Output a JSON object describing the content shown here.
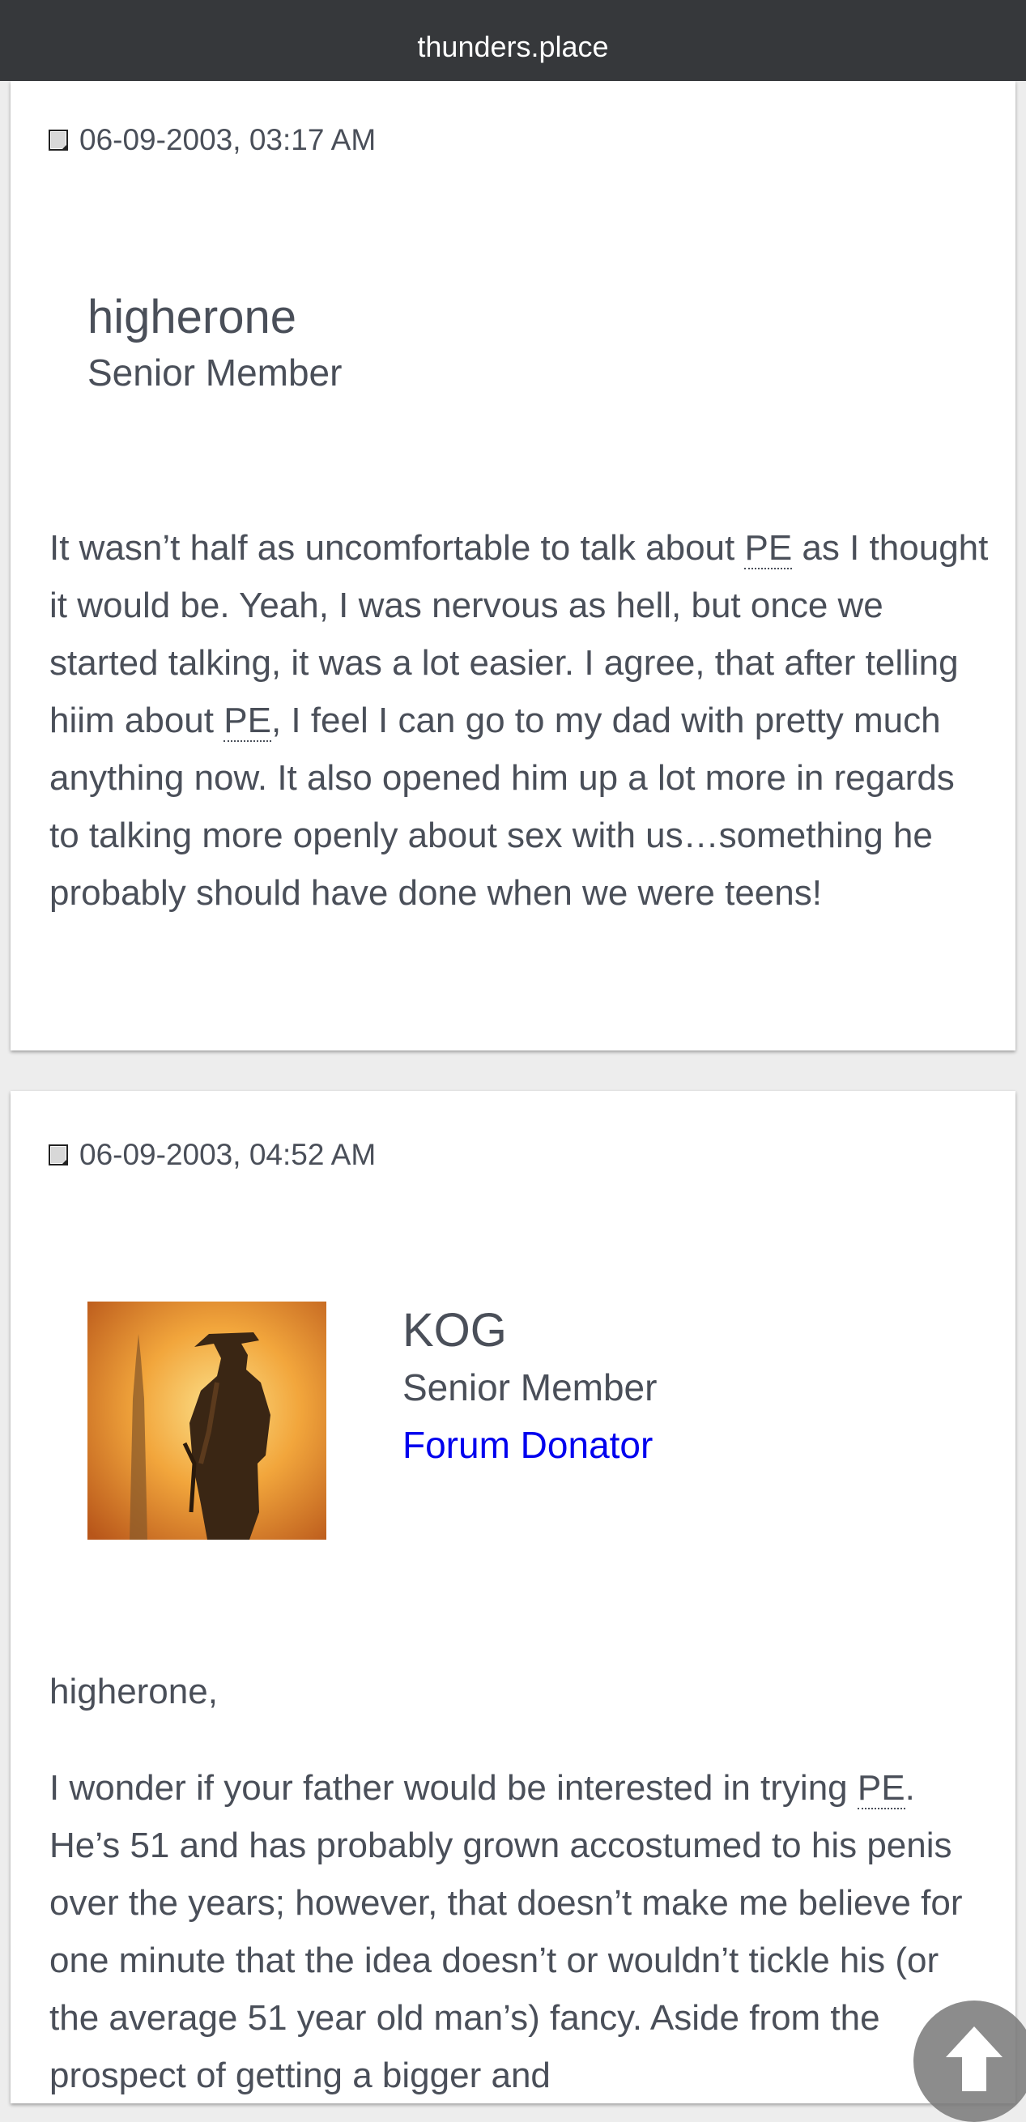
{
  "topbar": {
    "site": "thunders.place"
  },
  "posts": [
    {
      "date": "06-09-2003, 03:17 AM",
      "username": "higherone",
      "usertitle": "Senior Member",
      "body": {
        "s1": "It wasn’t half as uncomfortable to talk about ",
        "abbr1": "PE",
        "s2": " as I thought it would be. Yeah, I was nervous as hell, but once we started talking, it was a lot easier. I agree, that after telling hiim about ",
        "abbr2": "PE",
        "s3": ", I feel I can go to my dad with pretty much anything now. It also opened him up a lot more in regards to talking more openly about sex with us…something he probably should have done when we were teens!"
      }
    },
    {
      "date": "06-09-2003, 04:52 AM",
      "username": "KOG",
      "usertitle": "Senior Member",
      "badge": "Forum Donator",
      "greeting": "higherone,",
      "body": {
        "s1": "I wonder if your father would be interested in trying ",
        "abbr1": "PE",
        "s2": ". He’s 51 and has probably grown accostumed to his penis over the years; however, that doesn’t make me believe for one minute that the idea doesn’t or wouldn’t tickle his (or the average 51 year old man’s) fancy. Aside from the prospect of getting a bigger and"
      }
    }
  ],
  "icons": {
    "post": "post-icon",
    "scroll_top": "arrow-up-icon"
  },
  "colors": {
    "topbar": "#36383b",
    "text": "#4a4f59",
    "link": "#0000ee",
    "background": "#ededed"
  }
}
